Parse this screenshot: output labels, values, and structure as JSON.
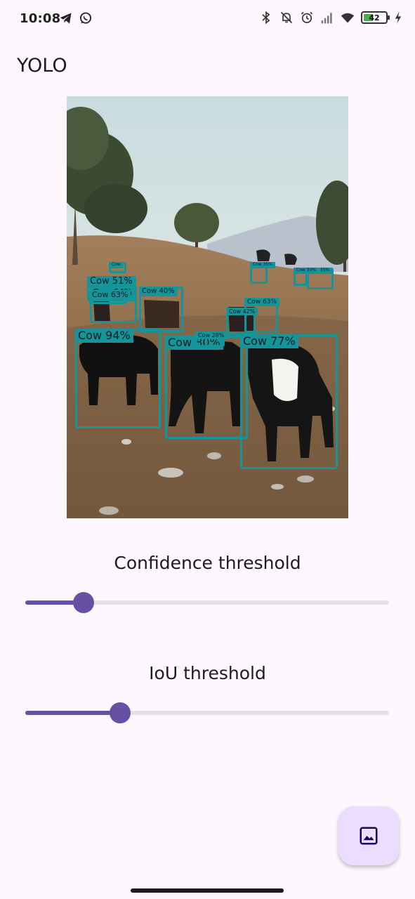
{
  "status_bar": {
    "time": "10:08",
    "left_icons": [
      "telegram-icon",
      "whatsapp-icon"
    ],
    "right_icons": [
      "bluetooth-icon",
      "notifications-off-icon",
      "alarm-icon",
      "signal-icon",
      "wifi-icon",
      "battery-icon",
      "charging-icon"
    ],
    "battery_level": "42",
    "battery_fraction": 0.42
  },
  "app_bar": {
    "title": "YOLO"
  },
  "detections": [
    {
      "label": "Cow 94%",
      "confidence": 0.94
    },
    {
      "label": "Cow 80%",
      "confidence": 0.8
    },
    {
      "label": "Cow 77%",
      "confidence": 0.77
    },
    {
      "label": "Cow 64%",
      "confidence": 0.64
    },
    {
      "label": "Cow 63%",
      "confidence": 0.63
    },
    {
      "label": "Cow 51%",
      "confidence": 0.51
    },
    {
      "label": "Cow 42%",
      "confidence": 0.42
    },
    {
      "label": "Cow 40%",
      "confidence": 0.4
    },
    {
      "label": "Cow 63%",
      "confidence": 0.63
    },
    {
      "label": "Cow 28%",
      "confidence": 0.28
    },
    {
      "label": "Cow 35%",
      "confidence": 0.35
    },
    {
      "label": "Cow 35%",
      "confidence": 0.35
    },
    {
      "label": "Cow 30%",
      "confidence": 0.3
    },
    {
      "label": "Cow",
      "confidence": null
    }
  ],
  "confidence": {
    "label": "Confidence threshold",
    "value": 0.16
  },
  "iou": {
    "label": "IoU threshold",
    "value": 0.26
  },
  "fab": {
    "icon": "image-icon"
  },
  "colors": {
    "accent": "#6750a4",
    "detection_box": "#15949a",
    "fab_background": "#eaddff",
    "background": "#fdf8fd"
  }
}
